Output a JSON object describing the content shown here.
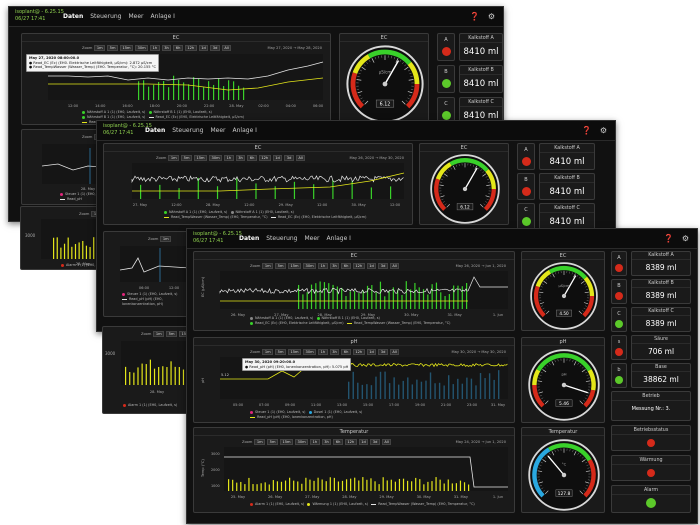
{
  "app": {
    "brand_line1": "isoplant@ - 6.25.15",
    "brand_line2": "06/27 17:41",
    "menu": [
      "Daten",
      "Steuerung",
      "Meer",
      "Anlage I"
    ]
  },
  "colors": {
    "bg": "#111111",
    "white_series": "#e6e6e6",
    "green_series": "#39d12a",
    "yellow_series": "#e4e61a",
    "green_led": "#5cc92a",
    "red_led": "#d52a1a"
  },
  "windows": {
    "back": {
      "ec_title": "EC",
      "zoom_label": "Zoom",
      "zoom_buttons": [
        "1m",
        "5m",
        "15m",
        "30m",
        "1h",
        "3h",
        "6h",
        "12h",
        "1d",
        "3d",
        "All"
      ],
      "range_from": "May 27, 2020",
      "range_to": "May 28, 2020",
      "tooltip_line1": "May 27, 2020 08:00:00.0",
      "tooltip_line2": "● Read_EC (Ec) (EH0. Elektrische Leitfähigkeit, µS/cm): 2.872 µS/cm",
      "tooltip_line3": "● Read_TempWasser (Wasser_Temp) (EH0. Temperatur, °C): 20.155 °C",
      "x_ticks": [
        "12:00",
        "14:00",
        "16:00",
        "18:00",
        "20:00",
        "22:00",
        "28. May",
        "02:00",
        "04:00",
        "06:00"
      ],
      "legend": [
        "Nährstoff A 1 (1) (EH0, Laufzeit, s)",
        "Nährstoff B 1 (1) (EH0, Laufzeit, s)",
        "Read_TempWasser (Wasser_Temp) (EH0, Temperatur, °C)",
        "Nährstoff B 1 (1) (EH0, Laufzeit, s)",
        "Read_EC (Ec) (EH0, Elektrische Leitfähigkeit, µS/cm)"
      ],
      "gauge_title": "EC",
      "gauge_value": "6.12",
      "gauge_unit": "µS/cm",
      "y_boxes": [
        "A",
        "B",
        "C"
      ],
      "counters": [
        {
          "title": "Kalkstoff A",
          "value": "8410 ml"
        },
        {
          "title": "Kalkstoff B",
          "value": "8410 ml"
        },
        {
          "title": "Kalkstoff C",
          "value": "8410 ml"
        }
      ],
      "panel2_legend": [
        "Steuer 1 (1) (EH0, Laufzeit, s)",
        "Read_pH"
      ],
      "panel3_legend": [
        "Alarm 1 (1) (EH0, Laufzeit, s)"
      ],
      "panel2_ticks": [
        "28. May"
      ],
      "panel3_ticks": [
        "28. May"
      ],
      "panel3_ylabel": "3000"
    },
    "middle": {
      "ec_title": "EC",
      "zoom_label": "Zoom",
      "zoom_buttons": [
        "1m",
        "5m",
        "15m",
        "30m",
        "1h",
        "3h",
        "6h",
        "12h",
        "1d",
        "3d",
        "All"
      ],
      "range_from": "May 26, 2020",
      "range_to": "May 30, 2020",
      "x_ticks": [
        "27. May",
        "12:00",
        "28. May",
        "12:00",
        "29. May",
        "12:00",
        "30. May",
        "12:00"
      ],
      "legend": [
        "Nährstoff A 1 (1) (EH0, Laufzeit, s)",
        "Nährstoff A 1 (1) (EH0, Laufzeit, s)",
        "Read_TempWasser (Wasser_Temp) (EH0, Temperatur, °C)",
        "Read_EC (Ec) (EH0, Elektrische Leitfähigkeit, µS/cm)"
      ],
      "gauge_title": "EC",
      "gauge_value": "6.12",
      "y_boxes": [
        "A",
        "B",
        "C"
      ],
      "counters": [
        {
          "title": "Kalkstoff A",
          "value": "8410 ml"
        },
        {
          "title": "Kalkstoff B",
          "value": "8410 ml"
        },
        {
          "title": "Kalkstoff C",
          "value": "8410 ml"
        }
      ],
      "panel2_legend": [
        "Steuer 1 (1) (EH0, Laufzeit, s)",
        "Read_pH (pH) (EH0, Ionenkonzentration, pH)"
      ],
      "panel3_legend": [
        "Alarm 1 (1) (EH0, Laufzeit, s)"
      ],
      "panel2_ticks": [
        "06:00",
        "12:00"
      ],
      "panel3_ticks": [
        "28. May"
      ],
      "panel3_ylabel": "3000"
    },
    "front": {
      "ec": {
        "title": "EC",
        "zoom_label": "Zoom",
        "zoom_buttons": [
          "1m",
          "5m",
          "15m",
          "30m",
          "1h",
          "3h",
          "6h",
          "12h",
          "1d",
          "3d",
          "All"
        ],
        "range_from": "May 26, 2020",
        "range_to": "Jun 1, 2020",
        "y_axis": "EC (µS/cm)",
        "x_ticks": [
          "26. May",
          "27. May",
          "28. May",
          "29. May",
          "30. May",
          "31. May",
          "1. Jun"
        ],
        "legend": [
          "Nährstoff A 1 (1) (EH0, Laufzeit, s)",
          "Nährstoff B 1 (1) (EH0, Laufzeit, s)",
          "Read_TempWasser (Wasser_Temp) (EH0, Temperatur, °C)",
          "Read_EC (Ec) (EH0, Elektrische Leitfähigkeit, µS/cm)"
        ]
      },
      "ph": {
        "title": "pH",
        "zoom_label": "Zoom",
        "zoom_buttons": [
          "1m",
          "5m",
          "15m",
          "30m",
          "1h",
          "3h",
          "6h",
          "12h",
          "1d",
          "3d",
          "All"
        ],
        "range_from": "May 30, 2020",
        "range_to": "May 30, 2020",
        "y_axis": "pH",
        "tooltip_line1": "May 30, 2020 09:20:00.0",
        "tooltip_line2": "● Read_pH (pH) (EH0, Ionenkonzentration, pH): 5.075 pH",
        "y_val": "5.12",
        "x_ticks": [
          "05:00",
          "07:00",
          "09:00",
          "11:00",
          "13:00",
          "15:00",
          "17:00",
          "19:00",
          "21:00",
          "23:00",
          "31. May"
        ],
        "legend": [
          "Steuer 1 (1) (EH0, Laufzeit, s)",
          "Read_pH (pH) (EH0, Ionenkonzentration, pH)",
          "Dosel 1 (1) (EH0, Laufzeit, s)"
        ]
      },
      "temp": {
        "title": "Temperatur",
        "zoom_label": "Zoom",
        "zoom_buttons": [
          "1m",
          "5m",
          "15m",
          "30m",
          "1h",
          "3h",
          "6h",
          "12h",
          "1d",
          "3d",
          "All"
        ],
        "range_from": "May 24, 2020",
        "range_to": "Jun 1, 2020",
        "y_axis": "Temp (°C)",
        "y_ticks": [
          "3000",
          "2000",
          "1000"
        ],
        "x_ticks": [
          "25. May",
          "26. May",
          "27. May",
          "28. May",
          "29. May",
          "30. May",
          "31. May",
          "1. Jun"
        ],
        "legend": [
          "Alarm 1 (1) (EH0, Laufzeit, s)",
          "Wärmung 1 (1) (EH0, Laufzeit, s)",
          "Read_TempWasser (Wasser_Temp) (EH0, Temperatur, °C)"
        ]
      },
      "gauges": [
        {
          "title": "EC",
          "value": "4.50",
          "unit": "µS/cm",
          "type": "ec"
        },
        {
          "title": "pH",
          "value": "5.46",
          "unit": "pH",
          "type": "ph"
        },
        {
          "title": "Temperatur",
          "value": "127.8",
          "unit": "°C",
          "type": "temp"
        }
      ],
      "y_boxes": [
        {
          "label": "A",
          "led": "red"
        },
        {
          "label": "B",
          "led": "red"
        },
        {
          "label": "C",
          "led": "green"
        },
        {
          "label": "s",
          "led": "red"
        },
        {
          "label": "b",
          "led": "green"
        }
      ],
      "counters": [
        {
          "title": "Kalkstoff A",
          "value": "8389 ml"
        },
        {
          "title": "Kalkstoff B",
          "value": "8389 ml"
        },
        {
          "title": "Kalkstoff C",
          "value": "8389 ml"
        },
        {
          "title": "Säure",
          "value": "706 ml"
        },
        {
          "title": "Base",
          "value": "38862 ml"
        }
      ],
      "status_title": "Betrieb",
      "status_value": "Messung Nr.: 3.",
      "indicators": [
        {
          "title": "Betriebsstatus",
          "led": "red"
        },
        {
          "title": "Wärmung",
          "led": "red"
        },
        {
          "title": "Alarm",
          "led": "green"
        }
      ]
    }
  }
}
